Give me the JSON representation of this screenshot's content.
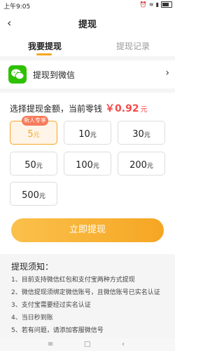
{
  "status": {
    "time": "上午9:05",
    "icons": [
      "alarm-icon",
      "wifi-icon",
      "signal-icon",
      "battery-icon"
    ]
  },
  "nav": {
    "title": "提现",
    "back_icon": "back-chevron-icon"
  },
  "tabs": [
    {
      "label": "我要提现",
      "active": true
    },
    {
      "label": "提现记录",
      "active": false
    }
  ],
  "wechat": {
    "label": "提现到微信",
    "icon": "wechat-icon",
    "arrow_icon": "chevron-right-icon"
  },
  "amount": {
    "prefix": "选择提现金额，当前零钱",
    "currency": "￥",
    "value": "0.92",
    "unit": "元"
  },
  "options": [
    {
      "value": "5",
      "unit": "元",
      "selected": true,
      "badge": "新人专享"
    },
    {
      "value": "10",
      "unit": "元"
    },
    {
      "value": "30",
      "unit": "元"
    },
    {
      "value": "50",
      "unit": "元"
    },
    {
      "value": "100",
      "unit": "元"
    },
    {
      "value": "200",
      "unit": "元"
    },
    {
      "value": "500",
      "unit": "元"
    }
  ],
  "submit": {
    "label": "立即提现"
  },
  "notes": {
    "title": "提现须知：",
    "items": [
      "1、目前支持微信红包和支付宝两种方式提现",
      "2、微信提现须绑定微信账号，且微信账号已实名认证",
      "3、支付宝需要经过实名认证",
      "4、当日秒到账"
    ],
    "partial": "5、若有问题，请添加客服微信号"
  },
  "system_nav": {
    "menu_icon": "menu-icon",
    "home_icon": "home-icon",
    "back_icon": "back-icon"
  },
  "colors": {
    "accent": "#f5a623",
    "money": "#f54b4b",
    "wechat": "#2dc100",
    "badge": "#f77b5b"
  }
}
